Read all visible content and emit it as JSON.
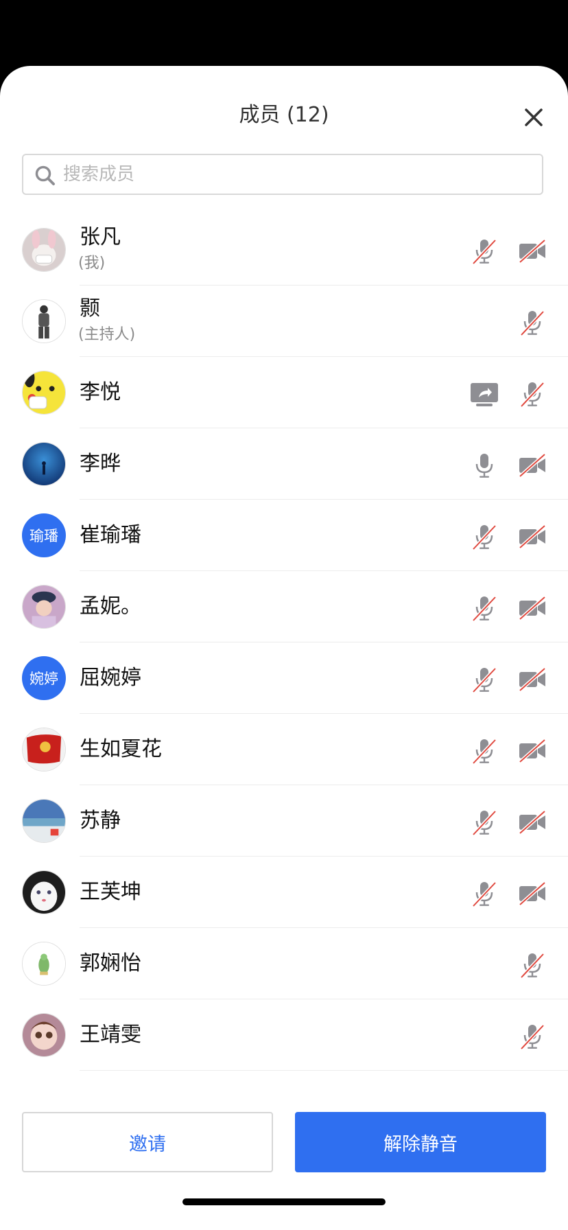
{
  "header": {
    "title": "成员 (12)"
  },
  "search": {
    "placeholder": "搜索成员"
  },
  "members": [
    {
      "name": "张凡",
      "role": "(我)",
      "avatar": "photo-rabbit-mask",
      "icons": [
        "mic-muted-icon",
        "camera-off-icon"
      ]
    },
    {
      "name": "颢",
      "role": "(主持人)",
      "avatar": "photo-person-standing",
      "icons": [
        "mic-muted-icon"
      ]
    },
    {
      "name": "李悦",
      "role": "",
      "avatar": "photo-pikachu",
      "icons": [
        "screen-share-icon",
        "mic-muted-icon"
      ]
    },
    {
      "name": "李晔",
      "role": "",
      "avatar": "photo-aquarium",
      "icons": [
        "mic-icon",
        "camera-off-icon"
      ]
    },
    {
      "name": "崔瑜璠",
      "role": "",
      "avatar_text": "瑜璠",
      "icons": [
        "mic-muted-icon",
        "camera-off-icon"
      ]
    },
    {
      "name": "孟妮。",
      "role": "",
      "avatar": "photo-girl-cap",
      "icons": [
        "mic-muted-icon",
        "camera-off-icon"
      ]
    },
    {
      "name": "屈婉婷",
      "role": "",
      "avatar_text": "婉婷",
      "icons": [
        "mic-muted-icon",
        "camera-off-icon"
      ]
    },
    {
      "name": "生如夏花",
      "role": "",
      "avatar": "photo-red-flag",
      "icons": [
        "mic-muted-icon",
        "camera-off-icon"
      ]
    },
    {
      "name": "苏静",
      "role": "",
      "avatar": "photo-beach",
      "icons": [
        "mic-muted-icon",
        "camera-off-icon"
      ]
    },
    {
      "name": "王芙坤",
      "role": "",
      "avatar": "photo-white-cat",
      "icons": [
        "mic-muted-icon",
        "camera-off-icon"
      ]
    },
    {
      "name": "郭娴怡",
      "role": "",
      "avatar": "photo-green-figure",
      "icons": [
        "mic-muted-icon"
      ]
    },
    {
      "name": "王靖雯",
      "role": "",
      "avatar": "photo-doll",
      "icons": [
        "mic-muted-icon"
      ]
    }
  ],
  "footer": {
    "invite_label": "邀请",
    "unmute_label": "解除静音"
  },
  "colors": {
    "accent": "#2f6ff0",
    "muted_slash": "#e0483e",
    "icon_gray": "#8e8e93"
  }
}
